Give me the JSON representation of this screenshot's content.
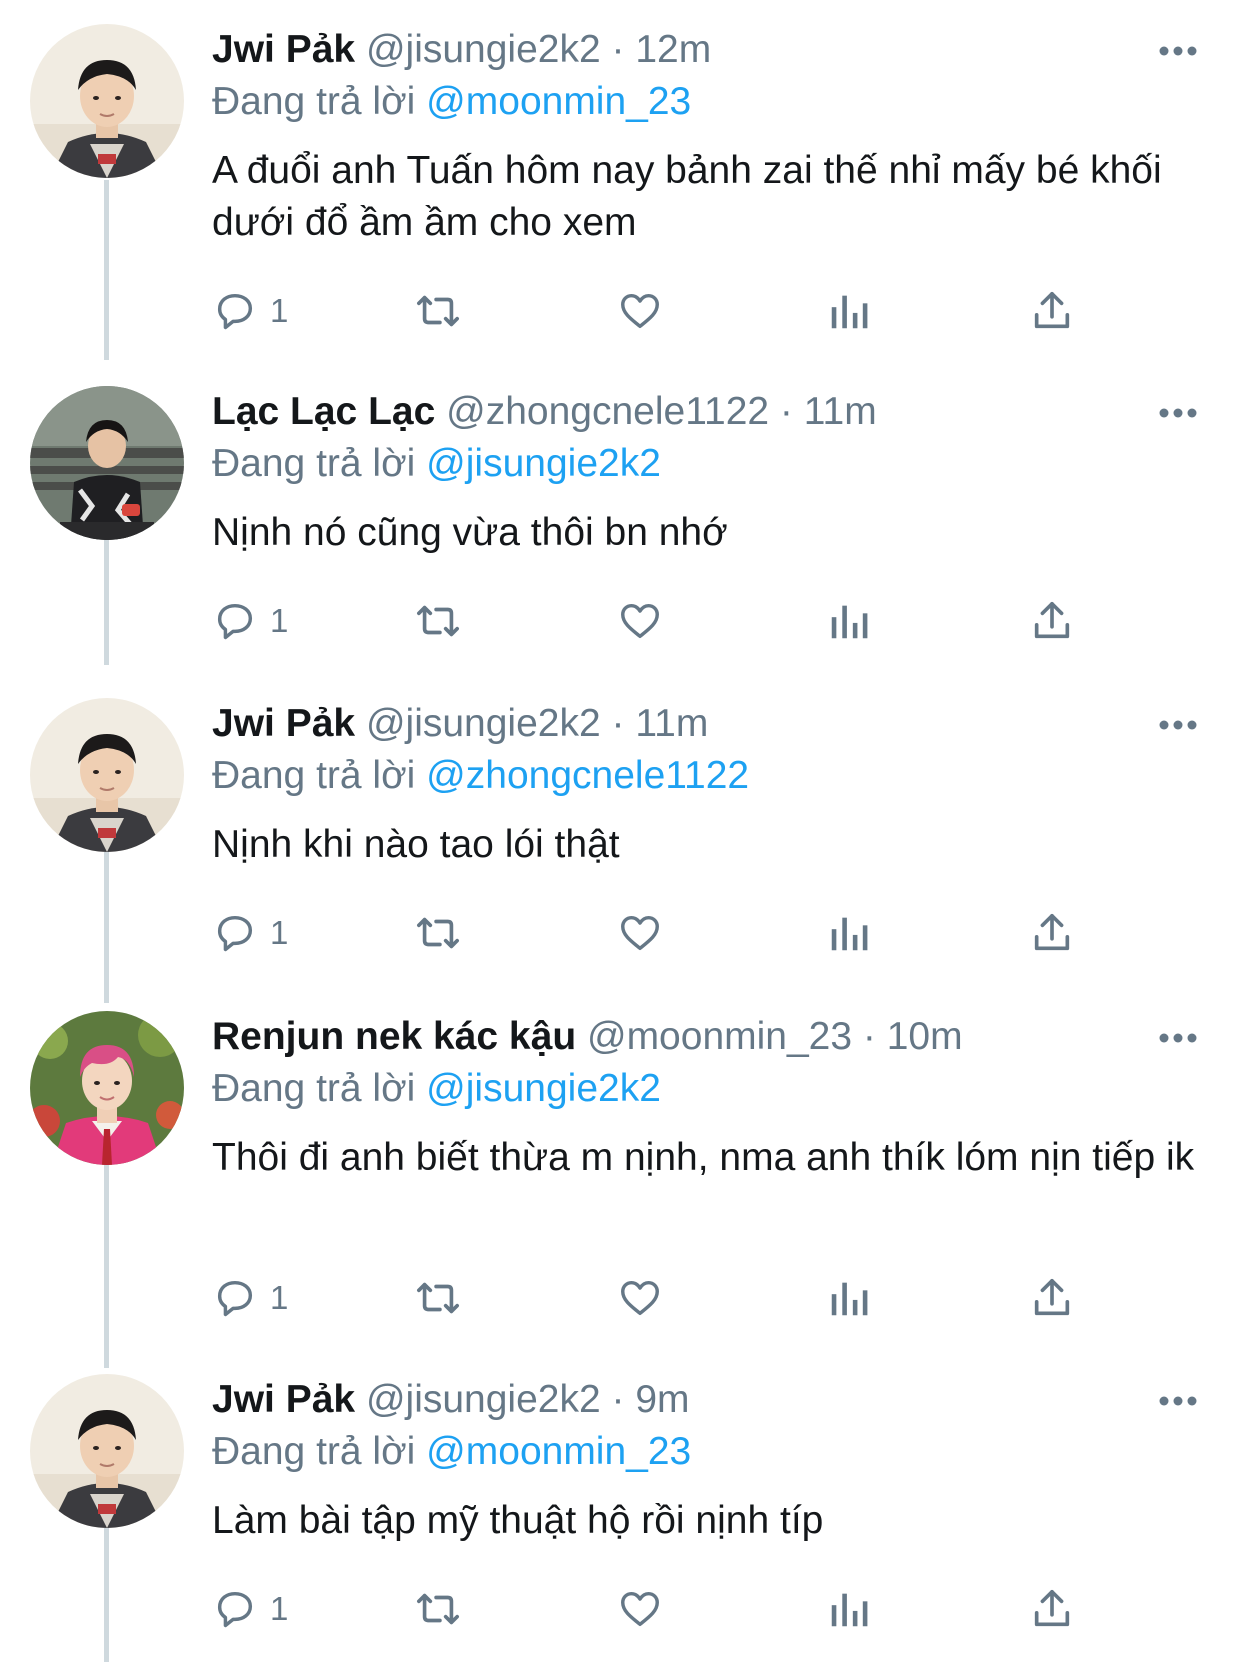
{
  "theme": {
    "text": "#14171a",
    "muted": "#657786",
    "link": "#1da1f2",
    "thread_line": "#cfd9de"
  },
  "reply_prefix": "Đang trả lời",
  "tweets": [
    {
      "name": "Jwi Pảk",
      "handle": "@jisungie2k2",
      "dot": "·",
      "time": "12m",
      "replying_to": "@moonmin_23",
      "text": "A đuổi anh Tuấn hôm nay bảnh zai thế nhỉ mấy bé khối dưới đổ ầm ầm cho xem",
      "reply_count": "1",
      "avatar": "boy-avatar"
    },
    {
      "name": "Lạc Lạc Lạc",
      "handle": "@zhongcnele1122",
      "dot": "·",
      "time": "11m",
      "replying_to": "@jisungie2k2",
      "text": "Nịnh nó cũng vừa thôi bn nhớ",
      "reply_count": "1",
      "avatar": "bench-avatar"
    },
    {
      "name": "Jwi Pảk",
      "handle": "@jisungie2k2",
      "dot": "·",
      "time": "11m",
      "replying_to": "@zhongcnele1122",
      "text": "Nịnh khi nào tao lói thật",
      "reply_count": "1",
      "avatar": "boy-avatar"
    },
    {
      "name": "Renjun nek kác kậu",
      "handle": "@moonmin_23",
      "dot": "·",
      "time": "10m",
      "replying_to": "@jisungie2k2",
      "text": "Thôi đi anh biết thừa m nịnh, nma anh thík lóm nịn tiếp ik",
      "reply_count": "1",
      "avatar": "pink-avatar"
    },
    {
      "name": "Jwi Pảk",
      "handle": "@jisungie2k2",
      "dot": "·",
      "time": "9m",
      "replying_to": "@moonmin_23",
      "text": "Làm bài tập mỹ thuật hộ rồi nịnh típ",
      "reply_count": "1",
      "avatar": "boy-avatar"
    }
  ]
}
